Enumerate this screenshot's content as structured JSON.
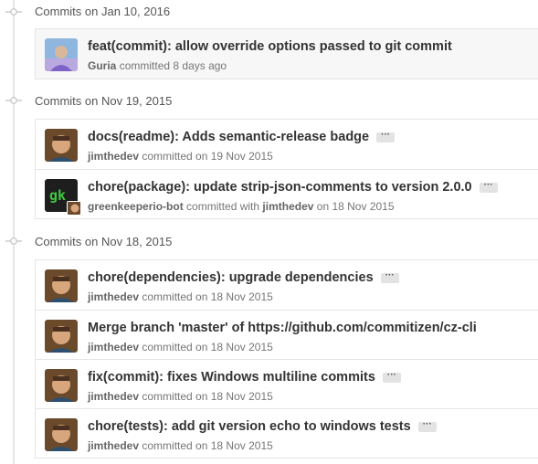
{
  "groups": [
    {
      "title": "Commits on Jan 10, 2016",
      "commits": [
        {
          "message": "feat(commit): allow override options passed to git commit",
          "author": "Guria",
          "action": "committed",
          "date": "8 days ago",
          "has_ellipsis": false,
          "avatar": "guria-avatar"
        }
      ]
    },
    {
      "title": "Commits on Nov 19, 2015",
      "commits": [
        {
          "message": "docs(readme): Adds semantic-release badge",
          "author": "jimthedev",
          "action": "committed on",
          "date": "19 Nov 2015",
          "has_ellipsis": true,
          "avatar": "jimthedev-avatar"
        },
        {
          "message": "chore(package): update strip-json-comments to version 2.0.0",
          "author": "greenkeeperio-bot",
          "action": "committed with",
          "coauthor": "jimthedev",
          "date": "on 18 Nov 2015",
          "has_ellipsis": true,
          "avatar": "greenkeeper-avatar"
        }
      ]
    },
    {
      "title": "Commits on Nov 18, 2015",
      "commits": [
        {
          "message": "chore(dependencies): upgrade dependencies",
          "author": "jimthedev",
          "action": "committed on",
          "date": "18 Nov 2015",
          "has_ellipsis": true,
          "avatar": "jimthedev-avatar"
        },
        {
          "message": "Merge branch 'master' of https://github.com/commitizen/cz-cli",
          "author": "jimthedev",
          "action": "committed on",
          "date": "18 Nov 2015",
          "has_ellipsis": false,
          "avatar": "jimthedev-avatar"
        },
        {
          "message": "fix(commit): fixes Windows multiline commits",
          "author": "jimthedev",
          "action": "committed on",
          "date": "18 Nov 2015",
          "has_ellipsis": true,
          "avatar": "jimthedev-avatar"
        },
        {
          "message": "chore(tests): add git version echo to windows tests",
          "author": "jimthedev",
          "action": "committed on",
          "date": "18 Nov 2015",
          "has_ellipsis": true,
          "avatar": "jimthedev-avatar"
        }
      ]
    }
  ],
  "ellipsis_text": "···",
  "colors": {
    "timeline": "#e5e5e5",
    "text": "#333333",
    "meta": "#767676",
    "greenkeeper": "#3fc93f"
  }
}
